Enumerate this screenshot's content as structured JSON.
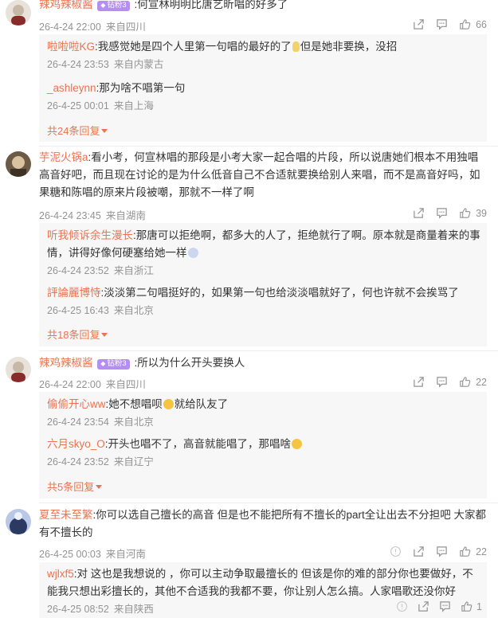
{
  "threads": [
    {
      "author": "辣鸡辣椒酱",
      "badge": "钻粉3",
      "text": ":何宣林明明比唐艺昕唱的好多了",
      "time": "26-4-24 22:00",
      "location": "来自四川",
      "likes": "66",
      "replies": [
        {
          "author": "啦啦啦KG",
          "text": ":我感觉她是四个人里第一句唱的最好的了",
          "text2": "但是她非要换，没招",
          "time": "26-4-24 23:53",
          "location": "来自内蒙古"
        },
        {
          "author": "_ashleynn",
          "text": ":那为啥不唱第一句",
          "time": "26-4-25 00:01",
          "location": "来自上海"
        }
      ],
      "more": "共24条回复"
    },
    {
      "author": "芋泥火锅a",
      "text": ":看小考，何宣林唱的那段是小考大家一起合唱的片段，所以说唐她们根本不用独唱高音好吧，而且现在讨论的是为什么低音自己不合适就要换给别人来唱，而不是高音好吗，如果糖和陈唱的原来片段被嘲，那就不一样了啊",
      "time": "26-4-24 23:45",
      "location": "来自湖南",
      "likes": "39",
      "replies": [
        {
          "author": "听我倾诉余生漫长",
          "text": ":那唐可以拒绝啊，都多大的人了，拒绝就行了啊。原本就是商量着来的事情，讲得好像何硬塞给她一样",
          "time": "26-4-24 23:52",
          "location": "来自浙江"
        },
        {
          "author": "評論麗博恃",
          "text": ":淡淡第二句唱挺好的，如果第一句也给淡淡唱就好了，何也许就不会挨骂了",
          "time": "26-4-25 16:43",
          "location": "来自北京"
        }
      ],
      "more": "共18条回复"
    },
    {
      "author": "辣鸡辣椒酱",
      "badge": "钻粉3",
      "text": ":所以为什么开头要换人",
      "time": "26-4-24 22:00",
      "location": "来自四川",
      "likes": "22",
      "replies": [
        {
          "author": "偷偷开心ww",
          "text": ":她不想唱呗",
          "text2": "就给队友了",
          "time": "26-4-24 23:54",
          "location": "来自北京"
        },
        {
          "author": "六月skyo_O",
          "text": ":开头也唱不了，高音就能唱了，那唱啥",
          "time": "26-4-24 23:52",
          "location": "来自辽宁"
        }
      ],
      "more": "共5条回复"
    },
    {
      "author": "夏至未至繁",
      "text": ":你可以选自己擅长的高音 但是也不能把所有不擅长的part全让出去不分担吧 大家都有不擅长的",
      "time": "26-4-25 00:03",
      "location": "来自河南",
      "likes": "22",
      "replies": [
        {
          "author": "wjlxf5",
          "text": ":对 这也是我想说的 ，你可以主动争取最擅长的 但该是你的难的部分你也要做好，不能我只想出彩擅长的，其他不合适我的我都不要，你让别人怎么搞。人家唱歌还没你好",
          "time": "26-4-25 08:52",
          "location": "来自陕西",
          "likes": "1"
        }
      ]
    }
  ],
  "icons": {
    "share": "share-icon",
    "comment": "comment-icon",
    "like": "thumbs-up-icon",
    "report": "report-icon"
  },
  "colors": {
    "accent": "#eb7350",
    "meta": "#939393",
    "reply_bg": "#f7f7f7",
    "badge": "#b48ef0"
  }
}
